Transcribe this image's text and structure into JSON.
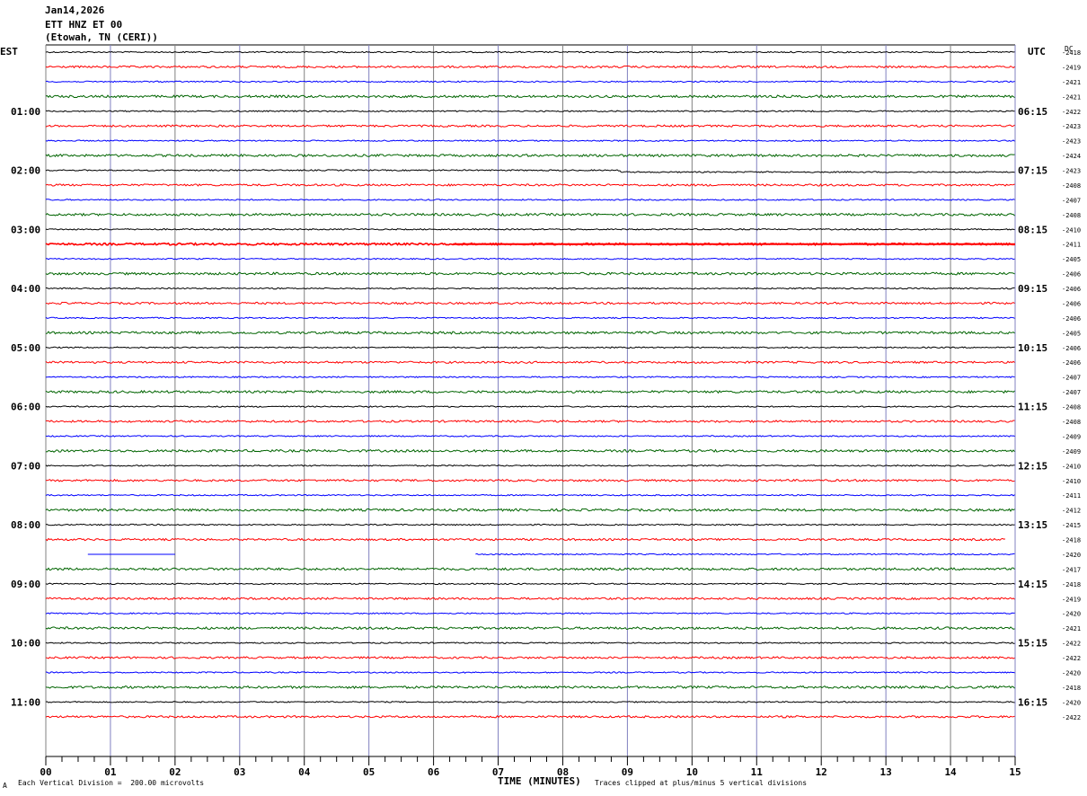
{
  "header": {
    "date": "Jan14,2026",
    "station": "ETT HNZ ET 00",
    "location": "(Etowah, TN (CERI))"
  },
  "left_tz": "EST",
  "right_tz": "UTC",
  "dc_label": "DC",
  "footer": {
    "scale": "Each Vertical Division =  200.00 microvolts",
    "clip": "Traces clipped at plus/minus 5 vertical divisions",
    "corner_mark": "A"
  },
  "colors": {
    "trace_cycle": [
      "#000000",
      "#ff0000",
      "#0000ff",
      "#006400"
    ],
    "grid_vertical": "#8080c0",
    "grid_vertical_alt": "#808080"
  },
  "chart_data": {
    "type": "line",
    "title": "Jan14,2026 ETT HNZ ET 00 (Etowah, TN (CERI))",
    "xlabel": "TIME (MINUTES)",
    "xlim": [
      0,
      15
    ],
    "x_ticks": [
      "00",
      "01",
      "02",
      "03",
      "04",
      "05",
      "06",
      "07",
      "08",
      "09",
      "10",
      "11",
      "12",
      "13",
      "14",
      "15"
    ],
    "left_time_labels": [
      "01:00",
      "02:00",
      "03:00",
      "04:00",
      "05:00",
      "06:00",
      "07:00",
      "08:00",
      "09:00",
      "10:00",
      "11:00"
    ],
    "right_time_labels": [
      "06:15",
      "07:15",
      "08:15",
      "09:15",
      "10:15",
      "11:15",
      "12:15",
      "13:15",
      "14:15",
      "15:15",
      "16:15"
    ],
    "dc_offsets": [
      "-2418",
      "-2419",
      "-2421",
      "-2421",
      "-2422",
      "-2423",
      "-2423",
      "-2424",
      "-2423",
      "-2408",
      "-2407",
      "-2408",
      "-2410",
      "-2411",
      "-2405",
      "-2406",
      "-2406",
      "-2406",
      "-2406",
      "-2405",
      "-2406",
      "-2406",
      "-2407",
      "-2407",
      "-2408",
      "-2408",
      "-2409",
      "-2409",
      "-2410",
      "-2410",
      "-2411",
      "-2412",
      "-2415",
      "-2418",
      "-2420",
      "-2417",
      "-2418",
      "-2419",
      "-2420",
      "-2421",
      "-2422",
      "-2422",
      "-2420",
      "-2418",
      "-2420",
      "-2422"
    ],
    "traces_per_hour": 4,
    "trace_minutes": 15,
    "gaps": [
      {
        "trace": 34,
        "from_min": 0,
        "to_min": 0.65
      },
      {
        "trace": 34,
        "from_min": 2.0,
        "to_min": 6.65
      },
      {
        "trace": 33,
        "from_min": 14.85,
        "to_min": 15
      }
    ],
    "segments": [
      {
        "trace": 34,
        "from_min": 0.65,
        "to_min": 2.0,
        "style": "flat"
      },
      {
        "trace": 13,
        "from_min": 6.3,
        "to_min": 15,
        "style": "thick"
      },
      {
        "trace": 8,
        "from_min": 8.9,
        "to_min": 15,
        "style": "offset"
      }
    ],
    "grid": true
  }
}
